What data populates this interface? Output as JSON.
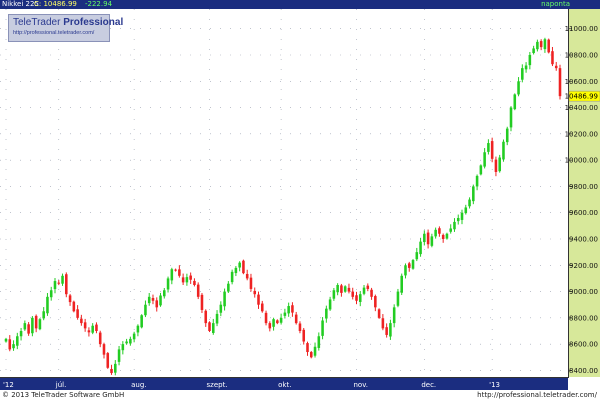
{
  "header": {
    "symbol": "Nikkei 225",
    "close_text": "C: 10486.99",
    "change": "-222.94",
    "period": "naponta"
  },
  "logo": {
    "name_regular": "TeleTrader",
    "name_bold": "Professional",
    "site": "http://professional.teletrader.com/"
  },
  "footer": {
    "copyright": "© 2013 TeleTrader Software GmbH",
    "url": "http://professional.teletrader.com/"
  },
  "colors": {
    "up": "#22cc22",
    "down": "#ee2222",
    "header_bg": "#1b2d80",
    "axis_bg": "#d7e89a",
    "last_price_bg": "#ffff00"
  },
  "chart_data": {
    "type": "candlestick",
    "y_axis": {
      "ylim": [
        8350,
        11150
      ],
      "ticks": [
        8400,
        8600,
        8800,
        9000,
        9200,
        9400,
        9600,
        9800,
        10000,
        10200,
        10400,
        10600,
        10800,
        11000
      ],
      "tick_labels": [
        "8400.00",
        "8600.00",
        "8800.00",
        "9000.00",
        "9200.00",
        "9400.00",
        "9600.00",
        "9800.00",
        "10000.00",
        "10200.00",
        "10400.00",
        "10600.00",
        "10800.00",
        "11000.00"
      ]
    },
    "x_axis": {
      "labels": [
        "'12",
        "júl.",
        "aug.",
        "szept.",
        "okt.",
        "nov.",
        "dec.",
        "'13"
      ],
      "label_positions": [
        0,
        14,
        34,
        54,
        73,
        93,
        111,
        129
      ]
    },
    "last_price": 10486.99,
    "last_price_label": "10486.99",
    "grid": true,
    "closes": [
      8640,
      8560,
      8600,
      8660,
      8700,
      8760,
      8680,
      8800,
      8720,
      8790,
      8850,
      8960,
      9010,
      9080,
      9060,
      9120,
      8980,
      8920,
      8850,
      8800,
      8760,
      8720,
      8690,
      8740,
      8700,
      8600,
      8520,
      8420,
      8380,
      8450,
      8560,
      8600,
      8620,
      8640,
      8680,
      8740,
      8820,
      8900,
      8960,
      8930,
      8880,
      8970,
      9010,
      9100,
      9170,
      9160,
      9120,
      9070,
      9110,
      9090,
      9050,
      8960,
      8860,
      8760,
      8700,
      8760,
      8830,
      8900,
      9000,
      9060,
      9150,
      9180,
      9220,
      9140,
      9100,
      9020,
      8980,
      8900,
      8850,
      8760,
      8720,
      8790,
      8760,
      8800,
      8840,
      8890,
      8840,
      8760,
      8700,
      8620,
      8540,
      8500,
      8580,
      8660,
      8780,
      8870,
      8940,
      9010,
      9050,
      8990,
      9040,
      9000,
      8960,
      8930,
      8980,
      9030,
      9020,
      8960,
      8880,
      8800,
      8720,
      8670,
      8760,
      8880,
      9000,
      9120,
      9200,
      9180,
      9240,
      9300,
      9380,
      9440,
      9360,
      9420,
      9470,
      9440,
      9400,
      9440,
      9480,
      9530,
      9560,
      9600,
      9640,
      9700,
      9800,
      9880,
      9960,
      10060,
      10130,
      10010,
      9910,
      10020,
      10140,
      10240,
      10400,
      10500,
      10600,
      10700,
      10720,
      10800,
      10850,
      10900,
      10860,
      10920,
      10820,
      10730,
      10700,
      10486.99
    ]
  }
}
